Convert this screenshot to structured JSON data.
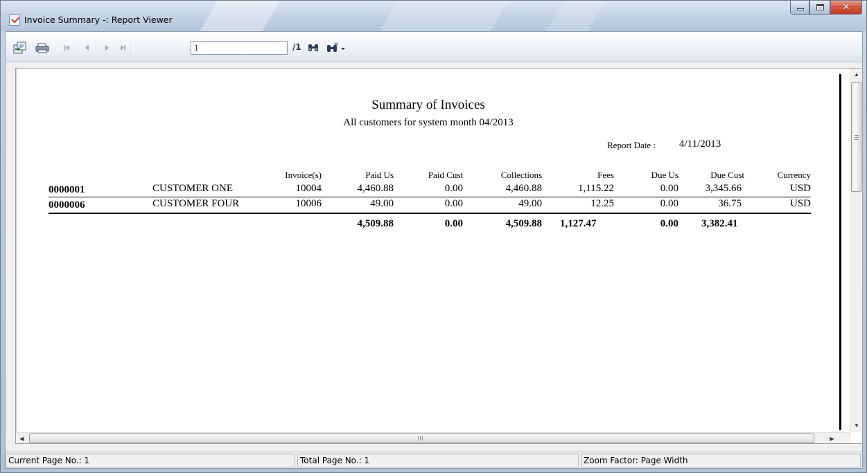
{
  "window": {
    "title": "Invoice Summary -: Report Viewer"
  },
  "toolbar": {
    "buttons": [
      "export-icon",
      "print-icon",
      "first-page-icon",
      "previous-page-icon",
      "next-page-icon",
      "last-page-icon",
      "find-icon",
      "zoom-icon"
    ],
    "page_input_value": "1",
    "page_total": "/1"
  },
  "report": {
    "title": "Summary of Invoices",
    "subtitle": "All customers for system month 04/2013",
    "report_date_label": "Report Date :",
    "report_date_value": "4/11/2013",
    "columns": [
      "Invoice(s)",
      "Paid Us",
      "Paid Cust",
      "Collections",
      "Fees",
      "Due Us",
      "Due Cust",
      "Currency"
    ],
    "rows": [
      {
        "id": "0000001",
        "customer": "CUSTOMER ONE",
        "invoice": "10004",
        "paid_us": "4,460.88",
        "paid_cust": "0.00",
        "collections": "4,460.88",
        "fees": "1,115.22",
        "due_us": "0.00",
        "due_cust": "3,345.66",
        "currency": "USD"
      },
      {
        "id": "0000006",
        "customer": "CUSTOMER FOUR",
        "invoice": "10006",
        "paid_us": "49.00",
        "paid_cust": "0.00",
        "collections": "49.00",
        "fees": "12.25",
        "due_us": "0.00",
        "due_cust": "36.75",
        "currency": "USD"
      }
    ],
    "totals": {
      "paid_us": "4,509.88",
      "paid_cust": "0.00",
      "collections": "4,509.88",
      "fees": "1,127.47",
      "due_us": "0.00",
      "due_cust": "3,382.41"
    }
  },
  "scrollbar": {
    "horizontal_grip": "III"
  },
  "statusbar": {
    "current_page": "Current Page No.: 1",
    "total_page": "Total Page No.: 1",
    "zoom": "Zoom Factor: Page Width"
  }
}
